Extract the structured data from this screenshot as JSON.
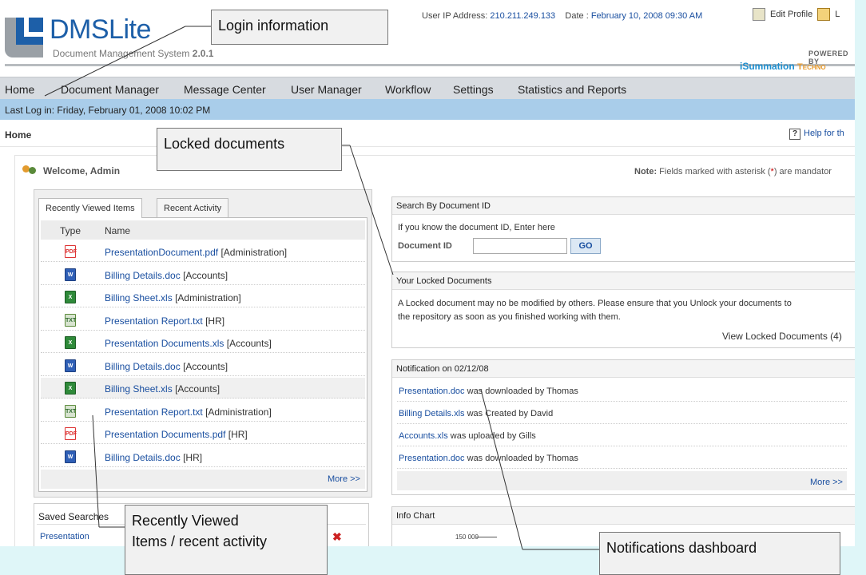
{
  "header": {
    "logo_text": "DMSLite",
    "logo_sub": "Document Management System",
    "version": "2.0.1",
    "ip_label": "User IP Address:",
    "ip_value": "210.211.249.133",
    "date_label": "Date :",
    "date_value": "February 10, 2008 09:30 AM",
    "edit_profile": "Edit Profile",
    "logout_partial": "L",
    "powered_by": "POWERED BY",
    "powered_brand": "iSummation",
    "powered_brand_2": "Techno"
  },
  "nav": {
    "items": [
      "Home",
      "Document Manager",
      "Message Center",
      "User Manager",
      "Workflow",
      "Settings",
      "Statistics and Reports"
    ]
  },
  "last_login": "Last Log in: Friday, February 01, 2008 10:02 PM",
  "breadcrumb": "Home",
  "help": "Help for th",
  "welcome": "Welcome, Admin",
  "note": {
    "label": "Note:",
    "text_before": "Fields marked with asterisk (",
    "asterisk": "*",
    "text_after": ") are mandator"
  },
  "left_panel": {
    "tabs": [
      "Recently Viewed Items",
      "Recent Activity"
    ],
    "columns": [
      "Type",
      "Name"
    ],
    "rows": [
      {
        "type": "pdf",
        "file": "PresentationDocument.pdf",
        "group": "[Administration]"
      },
      {
        "type": "doc",
        "file": "Billing Details.doc",
        "group": "[Accounts]"
      },
      {
        "type": "xls",
        "file": "Billing Sheet.xls",
        "group": "[Administration]"
      },
      {
        "type": "txt",
        "file": "Presentation Report.txt",
        "group": "[HR]"
      },
      {
        "type": "xls",
        "file": "Presentation Documents.xls",
        "group": "[Accounts]"
      },
      {
        "type": "doc",
        "file": "Billing Details.doc",
        "group": "[Accounts]"
      },
      {
        "type": "xls",
        "file": "Billing Sheet.xls",
        "group": "[Accounts]"
      },
      {
        "type": "txt",
        "file": "Presentation Report.txt",
        "group": "[Administration]"
      },
      {
        "type": "pdf",
        "file": "Presentation Documents.pdf",
        "group": "[HR]"
      },
      {
        "type": "doc",
        "file": "Billing Details.doc",
        "group": "[HR]"
      }
    ],
    "more": "More >>"
  },
  "saved_searches": {
    "title": "Saved Searches",
    "item": "Presentation",
    "delete": "✖"
  },
  "search_by_id": {
    "title": "Search By Document ID",
    "hint": "If you know the document ID, Enter here",
    "field_label": "Document ID",
    "field_value": "",
    "button": "GO"
  },
  "locked": {
    "title": "Your Locked Documents",
    "line1": "A Locked document may no be modified by others. Please ensure that you Unlock your documents to",
    "line2": "the repository as soon as you finished working with them.",
    "link": "View Locked Documents (4)"
  },
  "notifications": {
    "title": "Notification on 02/12/08",
    "items": [
      {
        "file": "Presentation.doc",
        "text": " was downloaded by Thomas"
      },
      {
        "file": "Billing Details.xls",
        "text": " was Created by David"
      },
      {
        "file": "Accounts.xls",
        "text": " was uploaded by Gills"
      },
      {
        "file": "Presentation.doc",
        "text": " was downloaded by Thomas"
      }
    ],
    "more": "More >>"
  },
  "info_chart": {
    "title": "Info Chart",
    "tick": "150 000"
  },
  "callouts": {
    "login": "Login information",
    "locked": "Locked documents",
    "recent_line1": "Recently Viewed",
    "recent_line2": "Items / recent activity",
    "notif": "Notifications dashboard"
  }
}
